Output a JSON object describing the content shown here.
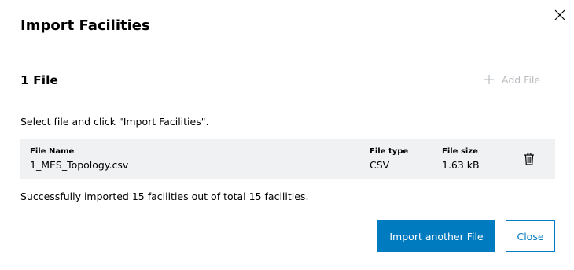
{
  "dialog": {
    "title": "Import Facilities",
    "close_icon": "close-icon"
  },
  "files_section": {
    "title": "1 File",
    "add_file_label": "Add File",
    "add_file_icon": "plus-icon",
    "add_file_enabled": false
  },
  "instruction": "Select file and click \"Import Facilities\".",
  "file_table": {
    "headers": {
      "name": "File Name",
      "type": "File type",
      "size": "File size"
    },
    "rows": [
      {
        "name": "1_MES_Topology.csv",
        "type": "CSV",
        "size": "1.63 kB",
        "delete_icon": "trash-icon"
      }
    ]
  },
  "status_message": "Successfully imported 15 facilities out of total 15 facilities.",
  "buttons": {
    "primary_label": "Import another File",
    "secondary_label": "Close"
  },
  "colors": {
    "accent": "#007bc0",
    "row_background": "#eff1f2",
    "disabled_text": "#b9bdc1"
  }
}
